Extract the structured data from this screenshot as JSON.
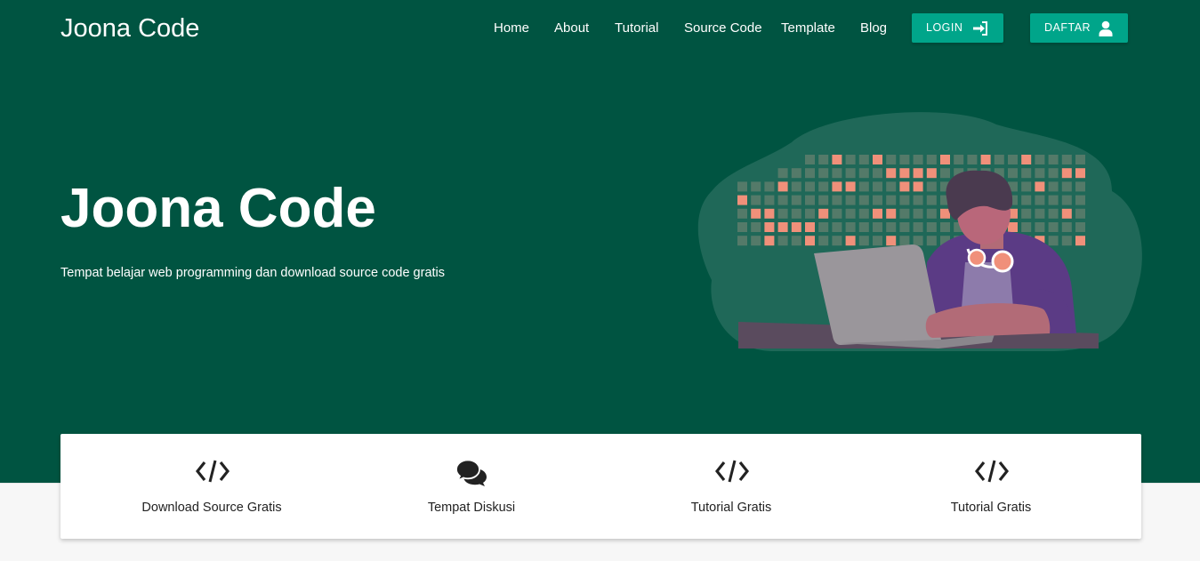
{
  "brand": "Joona Code",
  "nav": {
    "links": [
      "Home",
      "About",
      "Tutorial",
      "Source Code",
      "Template",
      "Blog"
    ],
    "login_label": "LOGIN",
    "login_icon": "sign-in-icon",
    "register_label": "DAFTAR",
    "register_icon": "user-icon"
  },
  "hero": {
    "title": "Joona Code",
    "subtitle": "Tempat belajar web programming dan download source code gratis",
    "illustration": "person-coding-on-laptop-illustration"
  },
  "features": [
    {
      "icon": "code-icon",
      "label": "Download Source Gratis"
    },
    {
      "icon": "comments-icon",
      "label": "Tempat Diskusi"
    },
    {
      "icon": "code-icon",
      "label": "Tutorial Gratis"
    },
    {
      "icon": "code-icon",
      "label": "Tutorial Gratis"
    }
  ],
  "colors": {
    "hero_bg": "#005441",
    "button": "#00a58a",
    "page_bg": "#f7f7f7",
    "illustration_accent": "#f0907a"
  }
}
